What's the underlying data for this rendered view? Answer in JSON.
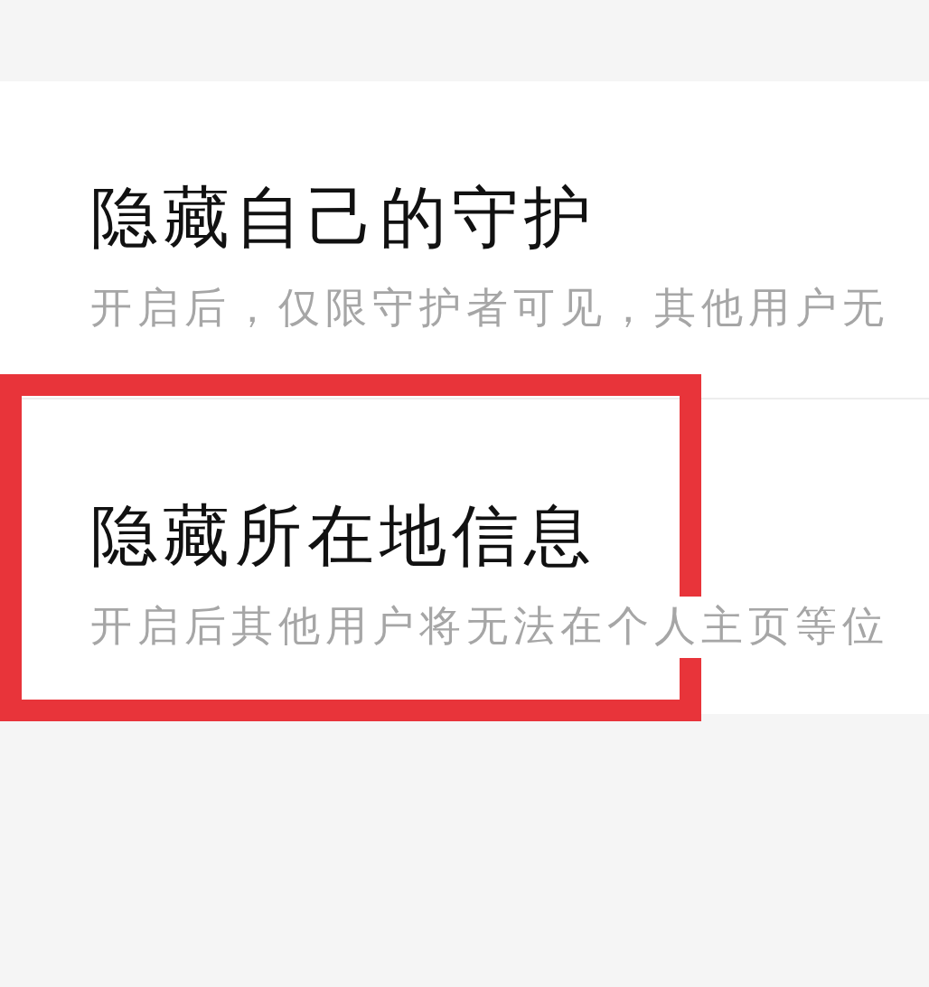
{
  "settings": [
    {
      "title": "隐藏自己的守护",
      "description": "开启后，仅限守护者可见，其他用户无",
      "highlighted": false
    },
    {
      "title": "隐藏所在地信息",
      "description": "开启后其他用户将无法在个人主页等位",
      "highlighted": true
    }
  ]
}
